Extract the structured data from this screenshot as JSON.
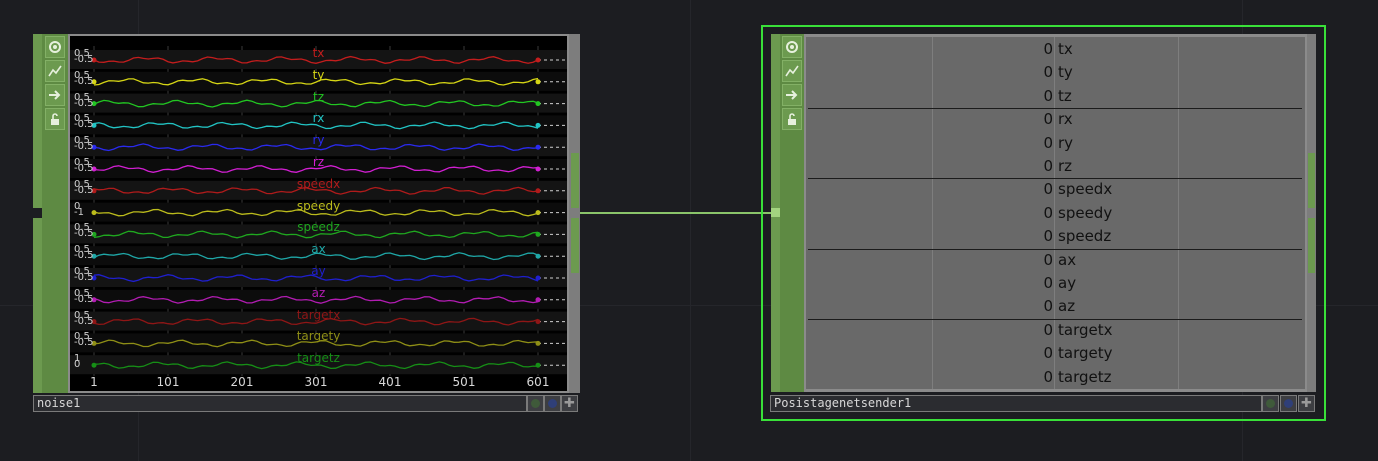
{
  "noise_node": {
    "name": "noise1",
    "channels": [
      {
        "name": "tx",
        "color": "#c41d1d",
        "range": "0.5\n-0.5"
      },
      {
        "name": "ty",
        "color": "#d6d615",
        "range": "0.5\n-0.5"
      },
      {
        "name": "tz",
        "color": "#22c722",
        "range": "0.5\n-0.5"
      },
      {
        "name": "rx",
        "color": "#22c4c4",
        "range": "0.5\n-0.5"
      },
      {
        "name": "ry",
        "color": "#2a2af0",
        "range": "0.5\n-0.5"
      },
      {
        "name": "rz",
        "color": "#d21fd2",
        "range": "0.5\n-0.5"
      },
      {
        "name": "speedx",
        "color": "#b01b1b",
        "range": "0.5\n-0.5"
      },
      {
        "name": "speedy",
        "color": "#bcbc1c",
        "range": "0\n-1"
      },
      {
        "name": "speedz",
        "color": "#1fa81f",
        "range": "0.5\n-0.5"
      },
      {
        "name": "ax",
        "color": "#1fa7a7",
        "range": "0.5\n-0.5"
      },
      {
        "name": "ay",
        "color": "#1f1fcf",
        "range": "0.5\n-0.5"
      },
      {
        "name": "az",
        "color": "#b21cb2",
        "range": "0.5\n-0.5"
      },
      {
        "name": "targetx",
        "color": "#8f1616",
        "range": "0.5\n-0.5"
      },
      {
        "name": "targety",
        "color": "#8f8f16",
        "range": "0.5\n-0.5"
      },
      {
        "name": "targetz",
        "color": "#168f16",
        "range": "1\n0"
      }
    ],
    "xticks": [
      "1",
      "101",
      "201",
      "301",
      "401",
      "501",
      "601"
    ]
  },
  "sender_node": {
    "name": "Posistagenetsender1",
    "rows": [
      {
        "value": "0",
        "name": "tx"
      },
      {
        "value": "0",
        "name": "ty"
      },
      {
        "value": "0",
        "name": "tz"
      },
      {
        "value": "0",
        "name": "rx"
      },
      {
        "value": "0",
        "name": "ry"
      },
      {
        "value": "0",
        "name": "rz"
      },
      {
        "value": "0",
        "name": "speedx"
      },
      {
        "value": "0",
        "name": "speedy"
      },
      {
        "value": "0",
        "name": "speedz"
      },
      {
        "value": "0",
        "name": "ax"
      },
      {
        "value": "0",
        "name": "ay"
      },
      {
        "value": "0",
        "name": "az"
      },
      {
        "value": "0",
        "name": "targetx"
      },
      {
        "value": "0",
        "name": "targety"
      },
      {
        "value": "0",
        "name": "targetz"
      }
    ]
  },
  "icons": [
    "viewer-active-icon",
    "bypass-icon",
    "cook-icon",
    "lock-icon"
  ],
  "colors": {
    "node_green": "#6c9a4f",
    "selected_border": "#39e039",
    "wire": "#8ac46a"
  }
}
